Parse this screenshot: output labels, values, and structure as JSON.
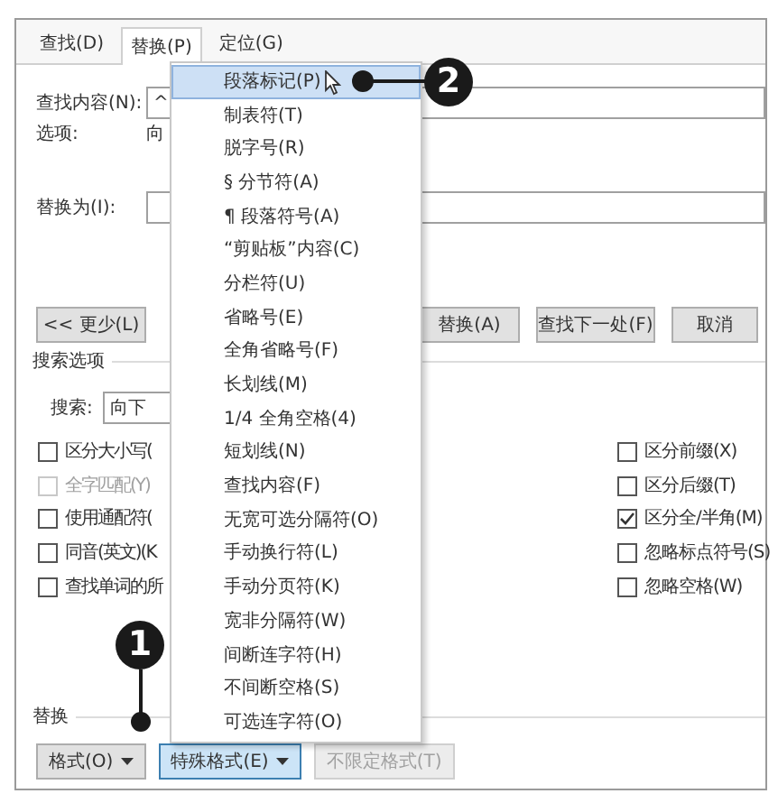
{
  "tabs": [
    {
      "label": "查找(D)",
      "selected": false
    },
    {
      "label": "替换(P)",
      "selected": true
    },
    {
      "label": "定位(G)",
      "selected": false
    }
  ],
  "find": {
    "label": "查找内容(N):",
    "value": "^"
  },
  "options": {
    "label": "选项:",
    "value": "向"
  },
  "replace": {
    "label": "替换为(I):"
  },
  "action_buttons": [
    {
      "label": "<< 更少(L)"
    },
    {
      "label": "替换(A)"
    },
    {
      "label": "查找下一处(F)"
    },
    {
      "label": "取消"
    }
  ],
  "search_options": {
    "title": "搜索选项",
    "search_label": "搜索:",
    "direction": "向下"
  },
  "left_checks": [
    {
      "label": "区分大小写(",
      "checked": false,
      "disabled": false
    },
    {
      "label": "全字匹配(Y)",
      "checked": false,
      "disabled": true
    },
    {
      "label": "使用通配符(",
      "checked": false,
      "disabled": false
    },
    {
      "label": "同音(英文)(K",
      "checked": false,
      "disabled": false
    },
    {
      "label": "查找单词的所",
      "checked": false,
      "disabled": false
    }
  ],
  "right_checks": [
    {
      "label": "区分前缀(X)",
      "checked": false,
      "disabled": false
    },
    {
      "label": "区分后缀(T)",
      "checked": false,
      "disabled": false
    },
    {
      "label": "区分全/半角(M)",
      "checked": true,
      "disabled": false
    },
    {
      "label": "忽略标点符号(S)",
      "checked": false,
      "disabled": false
    },
    {
      "label": "忽略空格(W)",
      "checked": false,
      "disabled": false
    }
  ],
  "replace_section": {
    "title": "替换",
    "buttons": [
      {
        "label": "格式(O)",
        "dropdown": true,
        "selected": false,
        "disabled": false
      },
      {
        "label": "特殊格式(E)",
        "dropdown": true,
        "selected": true,
        "disabled": false
      },
      {
        "label": "不限定格式(T)",
        "dropdown": false,
        "selected": false,
        "disabled": true
      }
    ]
  },
  "special_menu": {
    "items": [
      {
        "label": "段落标记(P)",
        "selected": true
      },
      {
        "label": "制表符(T)",
        "selected": false
      },
      {
        "label": "脱字号(R)",
        "selected": false
      },
      {
        "label": "§ 分节符(A)",
        "selected": false
      },
      {
        "label": "¶ 段落符号(A)",
        "selected": false
      },
      {
        "label": "“剪贴板”内容(C)",
        "selected": false
      },
      {
        "label": "分栏符(U)",
        "selected": false
      },
      {
        "label": "省略号(E)",
        "selected": false
      },
      {
        "label": "全角省略号(F)",
        "selected": false
      },
      {
        "label": "长划线(M)",
        "selected": false
      },
      {
        "label": "1/4 全角空格(4)",
        "selected": false
      },
      {
        "label": "短划线(N)",
        "selected": false
      },
      {
        "label": "查找内容(F)",
        "selected": false
      },
      {
        "label": "无宽可选分隔符(O)",
        "selected": false
      },
      {
        "label": "手动换行符(L)",
        "selected": false
      },
      {
        "label": "手动分页符(K)",
        "selected": false
      },
      {
        "label": "宽非分隔符(W)",
        "selected": false
      },
      {
        "label": "间断连字符(H)",
        "selected": false
      },
      {
        "label": "不间断空格(S)",
        "selected": false
      },
      {
        "label": "可选连字符(O)",
        "selected": false
      }
    ]
  },
  "callouts": [
    {
      "number": "1"
    },
    {
      "number": "2"
    }
  ]
}
